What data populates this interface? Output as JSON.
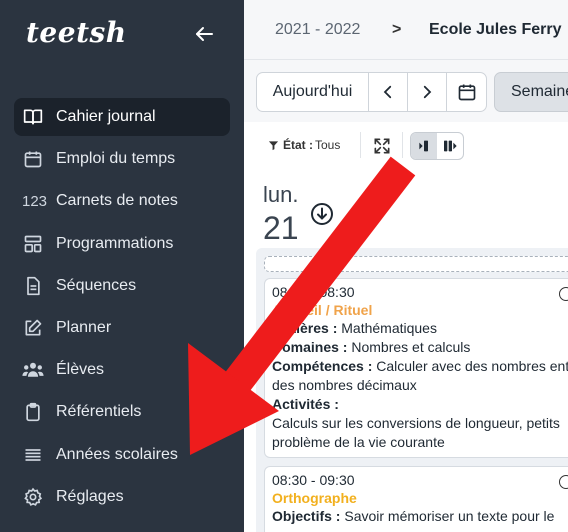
{
  "brand": {
    "name": "teetsh"
  },
  "sidebar": {
    "items": [
      {
        "label": "Cahier journal",
        "icon": "book-icon",
        "active": true
      },
      {
        "label": "Emploi du temps",
        "icon": "calendar-icon"
      },
      {
        "label": "Carnets de notes",
        "icon": "123-icon",
        "icon_text": "123"
      },
      {
        "label": "Programmations",
        "icon": "layout-icon"
      },
      {
        "label": "Séquences",
        "icon": "document-icon"
      },
      {
        "label": "Planner",
        "icon": "edit-icon"
      },
      {
        "label": "Élèves",
        "icon": "users-icon",
        "expandable": true
      },
      {
        "label": "Référentiels",
        "icon": "clipboard-icon"
      },
      {
        "label": "Années scolaires",
        "icon": "list-icon"
      },
      {
        "label": "Réglages",
        "icon": "gear-icon"
      }
    ]
  },
  "header": {
    "year": "2021 - 2022",
    "separator": ">",
    "school": "Ecole Jules Ferry"
  },
  "toolbar": {
    "today_label": "Aujourd'hui",
    "week_label": "Semaine"
  },
  "filters": {
    "state_label": "État :",
    "state_value": "Tous"
  },
  "day": {
    "name": "lun.",
    "number": "21"
  },
  "cards": [
    {
      "time": "08:00 - 08:30",
      "title": "Accueil / Rituel",
      "title_color": "#f0a34a",
      "matieres_label": "Matières :",
      "matieres": "Mathématiques",
      "domaines_label": "Domaines :",
      "domaines": "Nombres et calculs",
      "competences_label": "Compétences :",
      "competences_1": "Calculer avec des nombres ent",
      "competences_2": "des nombres décimaux",
      "activites_label": "Activités :",
      "activites_1": "Calculs sur les conversions de longueur, petits",
      "activites_2": "problème de la vie courante"
    },
    {
      "time": "08:30 - 09:30",
      "title": "Orthographe",
      "title_color": "#f2b01e",
      "objectifs_label": "Objectifs :",
      "objectifs_1": "Savoir mémoriser un texte pour le"
    }
  ],
  "colors": {
    "sidebar_bg": "#2b3440",
    "active_bg": "#1b222b",
    "arrow_red": "#ee1c1c"
  }
}
